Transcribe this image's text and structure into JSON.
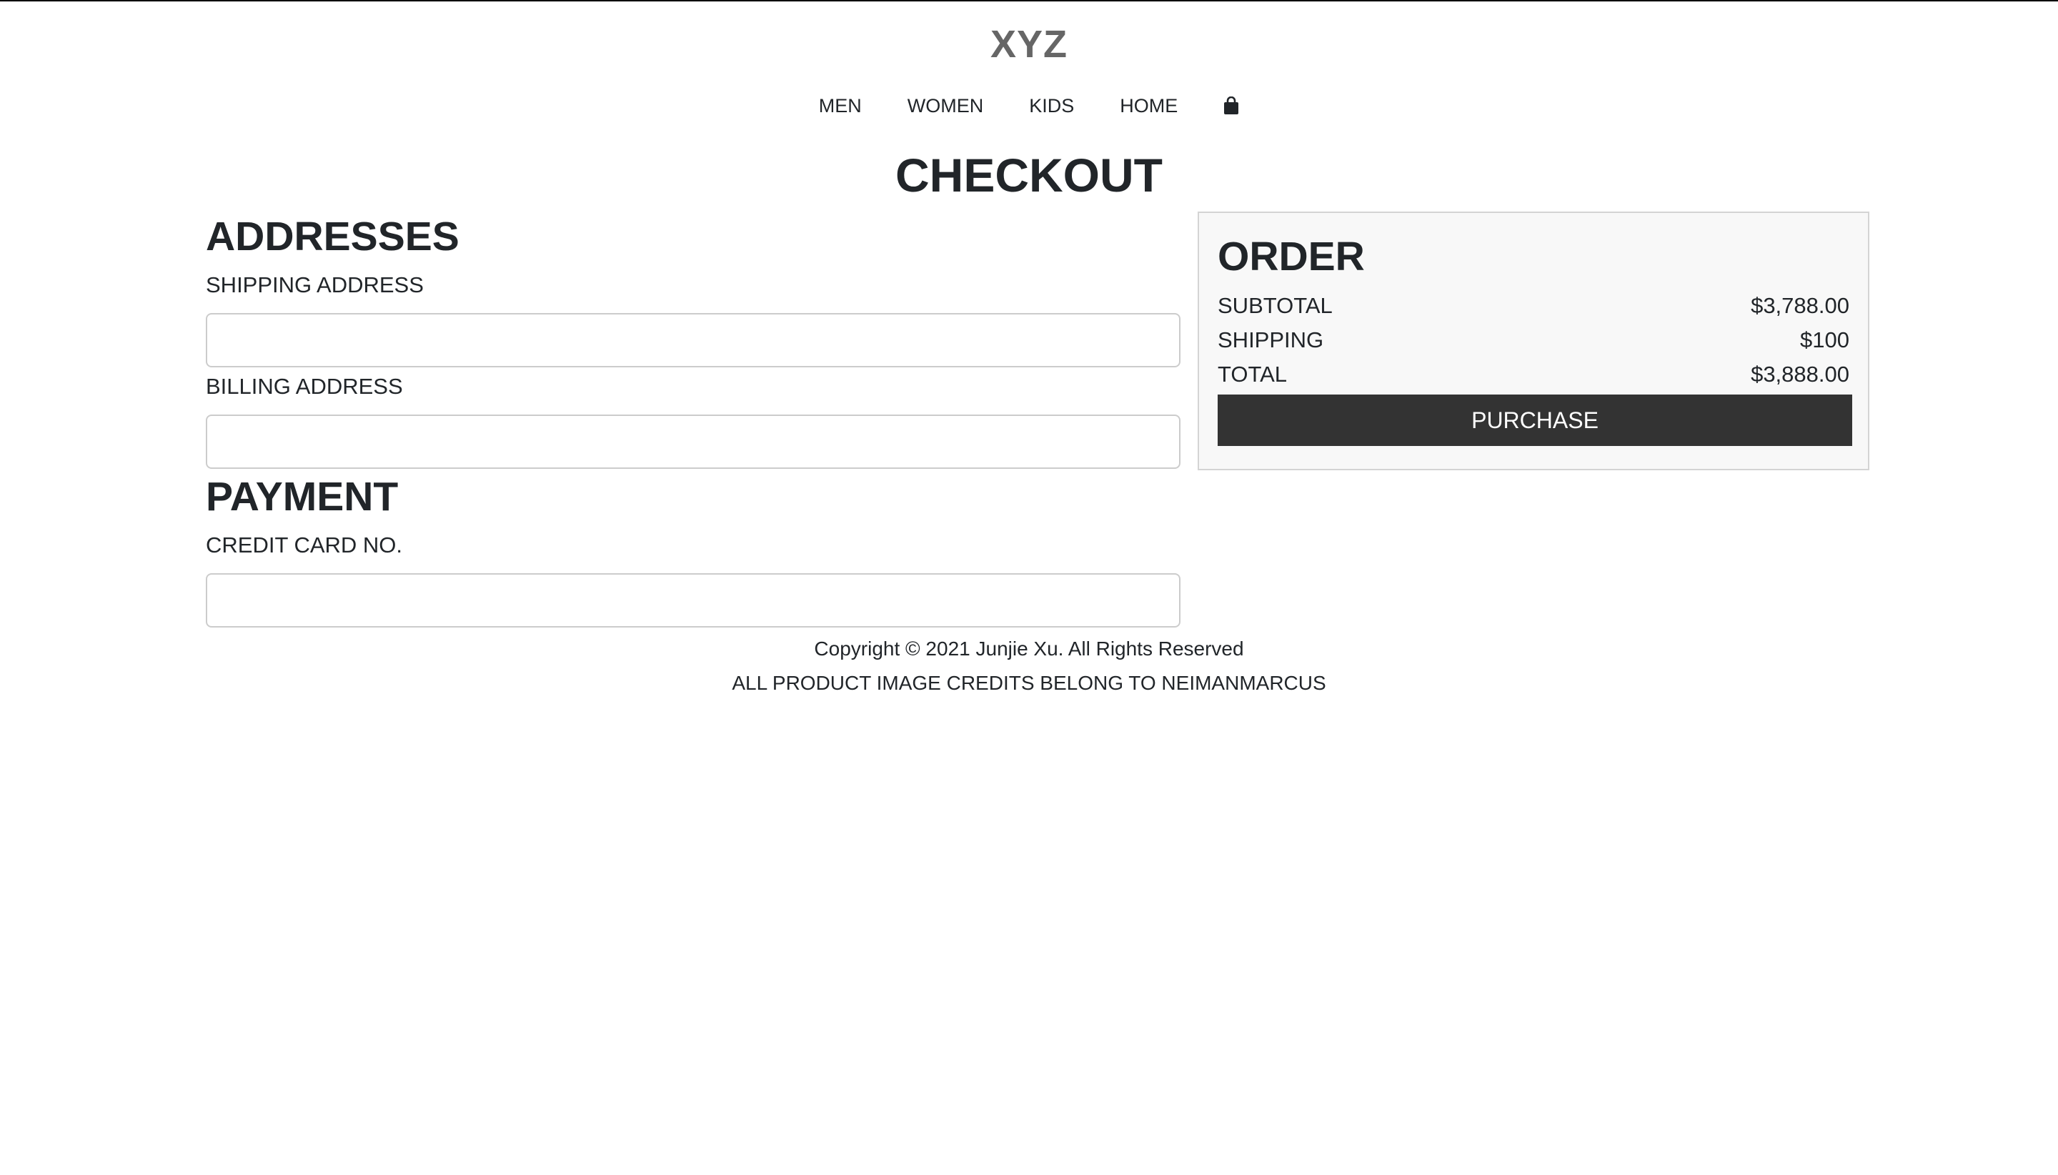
{
  "header": {
    "brand": "XYZ",
    "nav": [
      {
        "label": "MEN"
      },
      {
        "label": "WOMEN"
      },
      {
        "label": "KIDS"
      },
      {
        "label": "HOME"
      }
    ],
    "cart_icon": "shopping-bag-icon"
  },
  "page": {
    "title": "CHECKOUT"
  },
  "addresses": {
    "heading": "ADDRESSES",
    "shipping_label": "SHIPPING ADDRESS",
    "shipping_value": "",
    "billing_label": "BILLING ADDRESS",
    "billing_value": ""
  },
  "payment": {
    "heading": "PAYMENT",
    "card_label": "CREDIT CARD NO.",
    "card_value": ""
  },
  "order": {
    "heading": "ORDER",
    "rows": [
      {
        "label": "SUBTOTAL",
        "value": "$3,788.00"
      },
      {
        "label": "SHIPPING",
        "value": "$100"
      },
      {
        "label": "TOTAL",
        "value": "$3,888.00"
      }
    ],
    "purchase_label": "PURCHASE"
  },
  "footer": {
    "copyright": "Copyright © 2021 Junjie Xu. All Rights Reserved",
    "credits": "ALL PRODUCT IMAGE CREDITS BELONG TO NEIMANMARCUS"
  },
  "colors": {
    "button_bg": "#333333",
    "panel_bg": "#f8f8f8",
    "brand": "#666666"
  }
}
